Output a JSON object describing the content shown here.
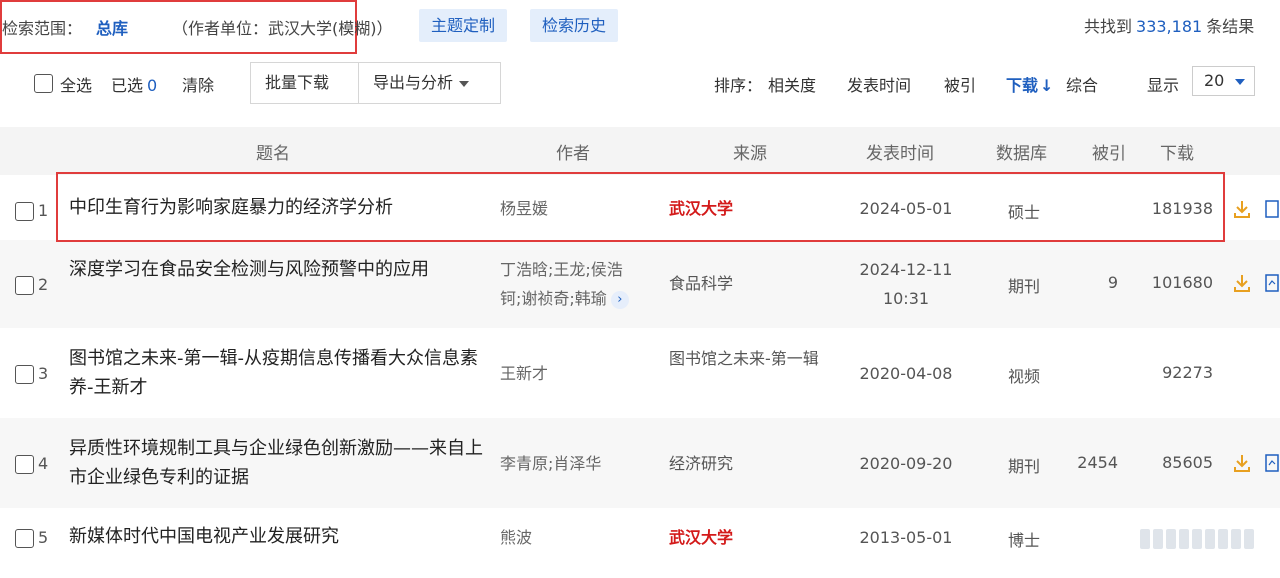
{
  "search": {
    "scope_label": "检索范围：",
    "scope_value": "总库",
    "affiliation": "（作者单位：武汉大学(模糊)）",
    "topic_button": "主题定制",
    "history_button": "检索历史",
    "found_prefix": "共找到",
    "found_count": "333,181",
    "found_suffix": "条结果"
  },
  "toolbar": {
    "select_all": "全选",
    "selected_label": "已选",
    "selected_count": "0",
    "clear": "清除",
    "batch_download": "批量下载",
    "export_analysis": "导出与分析",
    "sort_label": "排序：",
    "sort_options": [
      "相关度",
      "发表时间",
      "被引",
      "下载",
      "综合"
    ],
    "sort_active": "下载",
    "display_label": "显示",
    "display_value": "20"
  },
  "table": {
    "headers": [
      "题名",
      "作者",
      "来源",
      "发表时间",
      "数据库",
      "被引",
      "下载"
    ],
    "rows": [
      {
        "num": "1",
        "title": "中印生育行为影响家庭暴力的经济学分析",
        "author": "杨昱媛",
        "source": "武汉大学",
        "source_highlight": true,
        "date": "2024-05-01",
        "db": "硕士",
        "cite": "",
        "download": "181938"
      },
      {
        "num": "2",
        "title": "深度学习在食品安全检测与风险预警中的应用",
        "author": "丁浩晗;王龙;侯浩钶;谢祯奇;韩瑜",
        "source": "食品科学",
        "source_highlight": false,
        "date": "2024-12-11 10:31",
        "db": "期刊",
        "cite": "9",
        "download": "101680"
      },
      {
        "num": "3",
        "title": "图书馆之未来-第一辑-从疫期信息传播看大众信息素养-王新才",
        "author": "王新才",
        "source": "图书馆之未来-第一辑",
        "source_highlight": false,
        "date": "2020-04-08",
        "db": "视频",
        "cite": "",
        "download": "92273"
      },
      {
        "num": "4",
        "title": "异质性环境规制工具与企业绿色创新激励——来自上市企业绿色专利的证据",
        "author": "李青原;肖泽华",
        "source": "经济研究",
        "source_highlight": false,
        "date": "2020-09-20",
        "db": "期刊",
        "cite": "2454",
        "download": "85605"
      },
      {
        "num": "5",
        "title": "新媒体时代中国电视产业发展研究",
        "author": "熊波",
        "source": "武汉大学",
        "source_highlight": true,
        "date": "2013-05-01",
        "db": "博士",
        "cite": "",
        "download": ""
      }
    ]
  },
  "colors": {
    "accent_blue": "#1f5fbf",
    "highlight_red": "#d31a1a",
    "annotation_red": "#e03c3c",
    "download_icon": "#e8a020"
  },
  "icons": {
    "download": "download-icon",
    "read": "read-online-icon",
    "more": "chevron-right-icon"
  }
}
